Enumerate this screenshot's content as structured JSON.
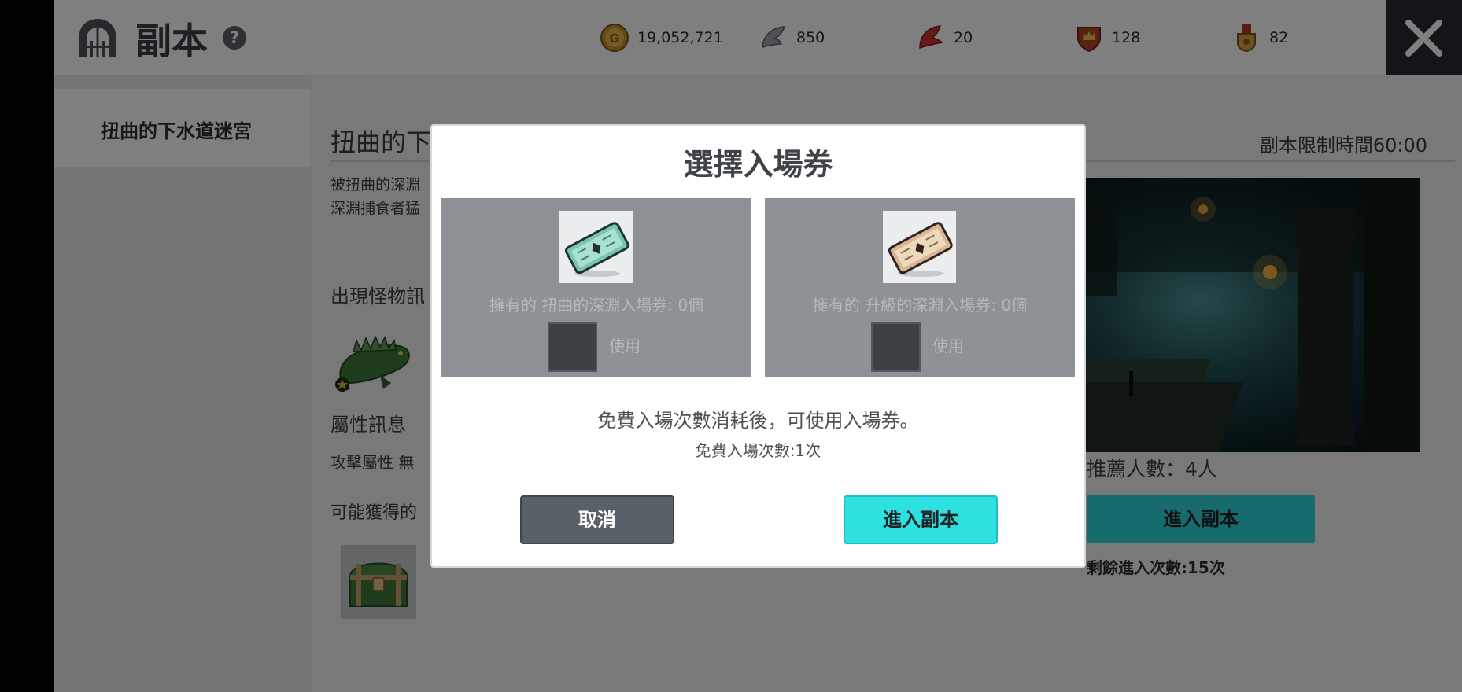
{
  "header": {
    "title": "副本",
    "help_icon": "?",
    "currencies": [
      {
        "icon": "gold-coin-icon",
        "value": "19,052,721"
      },
      {
        "icon": "silver-feather-icon",
        "value": "850"
      },
      {
        "icon": "red-feather-icon",
        "value": "20"
      },
      {
        "icon": "crown-shield-icon",
        "value": "128"
      },
      {
        "icon": "medal-icon",
        "value": "82"
      }
    ],
    "close_icon": "close-icon"
  },
  "sidebar": {
    "items": [
      {
        "label": "扭曲的下水道迷宮"
      }
    ]
  },
  "main": {
    "title": "扭曲的下",
    "time_limit": "副本限制時間60:00",
    "description_lines": [
      "被扭曲的深淵",
      "深淵捕食者猛"
    ],
    "monster_label": "出現怪物訊",
    "attribute_label": "屬性訊息",
    "attack_attribute": "攻擊屬性  無",
    "loot_label": "可能獲得的",
    "recommend": "推薦人數：4人",
    "enter_label": "進入副本",
    "remaining": "剩餘進入次數:15次"
  },
  "modal": {
    "title": "選擇入場券",
    "tickets": [
      {
        "owned": "擁有的 扭曲的深淵入場券: 0個",
        "use_label": "使用"
      },
      {
        "owned": "擁有的 升級的深淵入場券: 0個",
        "use_label": "使用"
      }
    ],
    "free_note": "免費入場次數消耗後，可使用入場券。",
    "free_count": "免費入場次數:1次",
    "cancel_label": "取消",
    "enter_label": "進入副本"
  },
  "colors": {
    "accent_cyan": "#2fe0e1",
    "button_dark": "#596068",
    "close_bg": "#272a30"
  }
}
